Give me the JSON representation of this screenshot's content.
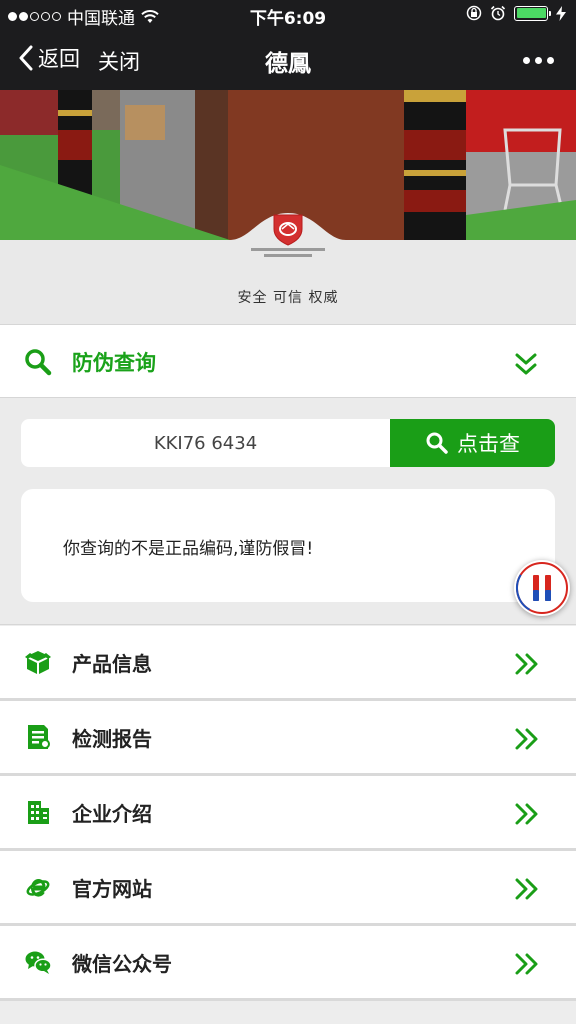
{
  "status_bar": {
    "carrier": "中国联通",
    "time": "下午6:09"
  },
  "nav": {
    "back_label": "返回",
    "close_label": "关闭",
    "title": "德鳳"
  },
  "banner": {
    "tagline": "安全  可信  权威"
  },
  "query": {
    "title": "防伪查询",
    "input_value": "KKI76 6434",
    "button_label": "点击查",
    "result": "你查询的不是正品编码,谨防假冒!"
  },
  "menu": {
    "items": [
      {
        "label": "产品信息",
        "icon": "package-icon"
      },
      {
        "label": "检测报告",
        "icon": "report-icon"
      },
      {
        "label": "企业介绍",
        "icon": "building-icon"
      },
      {
        "label": "官方网站",
        "icon": "browser-icon"
      },
      {
        "label": "微信公众号",
        "icon": "wechat-icon"
      }
    ]
  },
  "colors": {
    "brand_green": "#1a9e17",
    "bar_dark": "#1c1c1e",
    "battery_green": "#4cd964"
  }
}
